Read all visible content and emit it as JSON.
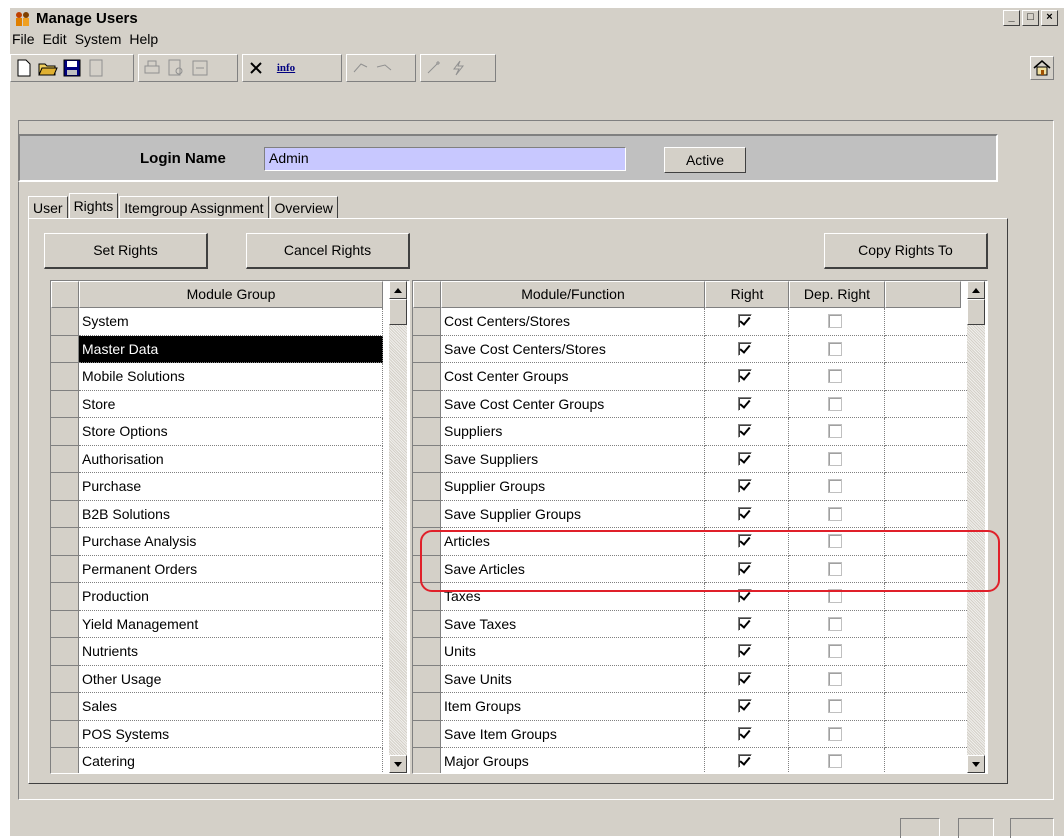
{
  "window": {
    "title": "Manage Users"
  },
  "menu": [
    "File",
    "Edit",
    "System",
    "Help"
  ],
  "toolbar": {
    "info_label": "info"
  },
  "login": {
    "label": "Login Name",
    "value": "Admin",
    "active_button": "Active"
  },
  "tabs": [
    "User",
    "Rights",
    "Itemgroup Assignment",
    "Overview"
  ],
  "selected_tab": "Rights",
  "buttons": {
    "set_rights": "Set Rights",
    "cancel_rights": "Cancel Rights",
    "copy_rights": "Copy Rights To"
  },
  "module_group": {
    "header": "Module Group",
    "selected": "Master Data",
    "rows": [
      "System",
      "Master Data",
      "Mobile Solutions",
      "Store",
      "Store Options",
      "Authorisation",
      "Purchase",
      "B2B Solutions",
      "Purchase Analysis",
      "Permanent Orders",
      "Production",
      "Yield Management",
      "Nutrients",
      "Other Usage",
      "Sales",
      "POS Systems",
      "Catering"
    ]
  },
  "functions": {
    "headers": {
      "name": "Module/Function",
      "right": "Right",
      "dep_right": "Dep. Right"
    },
    "rows": [
      {
        "name": "Cost Centers/Stores",
        "right": true,
        "dep": false
      },
      {
        "name": "Save Cost Centers/Stores",
        "right": true,
        "dep": false
      },
      {
        "name": "Cost Center Groups",
        "right": true,
        "dep": false
      },
      {
        "name": "Save Cost Center Groups",
        "right": true,
        "dep": false
      },
      {
        "name": "Suppliers",
        "right": true,
        "dep": false
      },
      {
        "name": "Save Suppliers",
        "right": true,
        "dep": false
      },
      {
        "name": "Supplier Groups",
        "right": true,
        "dep": false
      },
      {
        "name": "Save Supplier Groups",
        "right": true,
        "dep": false
      },
      {
        "name": "Articles",
        "right": true,
        "dep": false
      },
      {
        "name": "Save Articles",
        "right": true,
        "dep": false
      },
      {
        "name": "Taxes",
        "right": true,
        "dep": false
      },
      {
        "name": "Save Taxes",
        "right": true,
        "dep": false
      },
      {
        "name": "Units",
        "right": true,
        "dep": false
      },
      {
        "name": "Save Units",
        "right": true,
        "dep": false
      },
      {
        "name": "Item Groups",
        "right": true,
        "dep": false
      },
      {
        "name": "Save Item Groups",
        "right": true,
        "dep": false
      },
      {
        "name": "Major Groups",
        "right": true,
        "dep": false
      }
    ]
  },
  "colors": {
    "login_field_bg": "#c8c8ff",
    "highlight": "#e0202a",
    "face": "#d4d0c8"
  }
}
